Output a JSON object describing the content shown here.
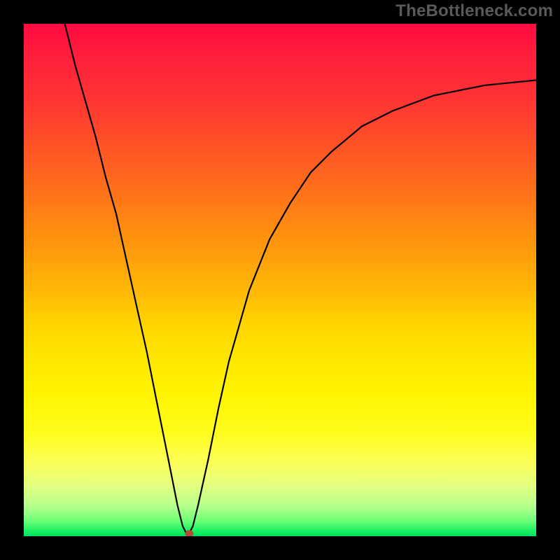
{
  "watermark": "TheBottleneck.com",
  "chart_data": {
    "type": "line",
    "title": "",
    "xlabel": "",
    "ylabel": "",
    "xlim": [
      0,
      100
    ],
    "ylim": [
      0,
      100
    ],
    "grid": false,
    "legend": false,
    "series": [
      {
        "name": "curve",
        "x": [
          8,
          10,
          12,
          14,
          16,
          18,
          20,
          22,
          24,
          26,
          28,
          30,
          31,
          32,
          33,
          34,
          36,
          38,
          40,
          44,
          48,
          52,
          56,
          60,
          66,
          72,
          80,
          90,
          100
        ],
        "y": [
          100,
          92,
          85,
          78,
          70,
          63,
          54,
          45,
          36,
          26,
          16,
          6,
          2,
          0,
          2,
          6,
          15,
          25,
          34,
          48,
          58,
          65,
          71,
          75,
          80,
          83,
          86,
          88,
          89
        ]
      }
    ],
    "marker": {
      "x": 32.3,
      "y": 0.5
    },
    "gradient_stops": [
      {
        "pos": 0.0,
        "color": "#ff0a40"
      },
      {
        "pos": 0.5,
        "color": "#ffc400"
      },
      {
        "pos": 0.8,
        "color": "#fffe22"
      },
      {
        "pos": 1.0,
        "color": "#00e060"
      }
    ]
  }
}
